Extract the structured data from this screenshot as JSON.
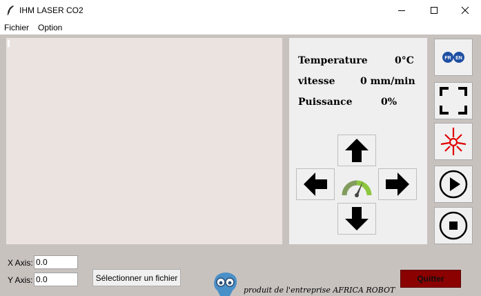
{
  "window": {
    "title": "IHM LASER CO2",
    "icon": "feather-icon",
    "controls": [
      "minimize-icon",
      "maximize-icon",
      "close-icon"
    ]
  },
  "menu": {
    "items": [
      {
        "label": "Fichier"
      },
      {
        "label": "Option"
      }
    ]
  },
  "stats": {
    "temperature_label": "Temperature",
    "temperature_value": "0°C",
    "speed_label": "vitesse",
    "speed_value": "0 mm/min",
    "power_label": "Puissance",
    "power_value": "0%"
  },
  "controls": {
    "directions": [
      "arrow-up-icon",
      "arrow-left-icon",
      "arrow-right-icon",
      "arrow-down-icon"
    ],
    "center": "speed-gauge-icon"
  },
  "side_buttons": [
    {
      "name": "language-toggle-button",
      "icon": "fr-en-flags-icon",
      "labels": [
        "FR",
        "EN"
      ]
    },
    {
      "name": "fullscreen-button",
      "icon": "fullscreen-icon"
    },
    {
      "name": "laser-button",
      "icon": "laser-icon"
    },
    {
      "name": "play-button",
      "icon": "play-icon"
    },
    {
      "name": "stop-button",
      "icon": "stop-icon"
    }
  ],
  "axes": {
    "x_label": "X Axis:",
    "x_value": "0.0",
    "y_label": "Y Axis:",
    "y_value": "0.0"
  },
  "file_button_label": "Sélectionner un fichier",
  "credit": "produit de l'entreprise AFRICA ROBOT",
  "quit_label": "Quitter",
  "colors": {
    "background": "#c8c2bf",
    "canvas": "#ebe3e0",
    "panel": "#efefef",
    "quit": "#8b0000",
    "laser": "#e00000",
    "gauge_green": "#8cc63f"
  }
}
